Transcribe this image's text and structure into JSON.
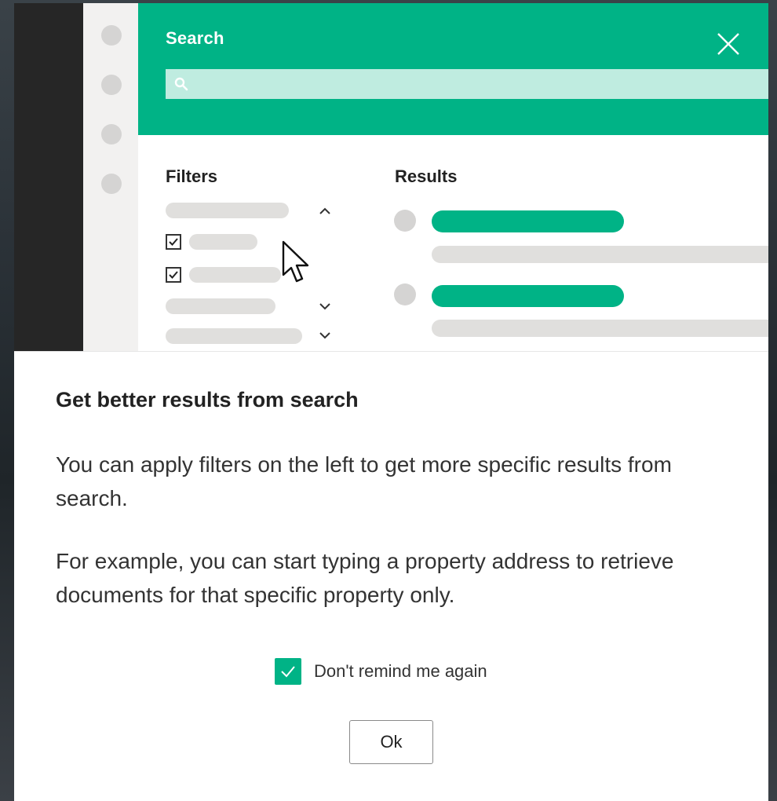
{
  "illustration": {
    "search_title": "Search",
    "filters_heading": "Filters",
    "results_heading": "Results",
    "icons": [
      "search-icon",
      "close-icon",
      "chevron-up-icon",
      "chevron-down-icon",
      "check-icon",
      "mouse-pointer-icon"
    ],
    "filter_checkboxes_checked": [
      true,
      true
    ],
    "colors": {
      "accent": "#00b386",
      "search_bar": "#bfece0",
      "placeholder": "#e0dfdd",
      "dark_rail": "#262626"
    }
  },
  "dialog": {
    "heading": "Get better results from search",
    "paragraph1": "You can apply filters on the left to get more specific results from search.",
    "paragraph2": "For example, you can start typing a property address to retrieve documents for that specific property only.",
    "remind_label": "Don't remind me again",
    "remind_checked": true,
    "ok_label": "Ok"
  }
}
